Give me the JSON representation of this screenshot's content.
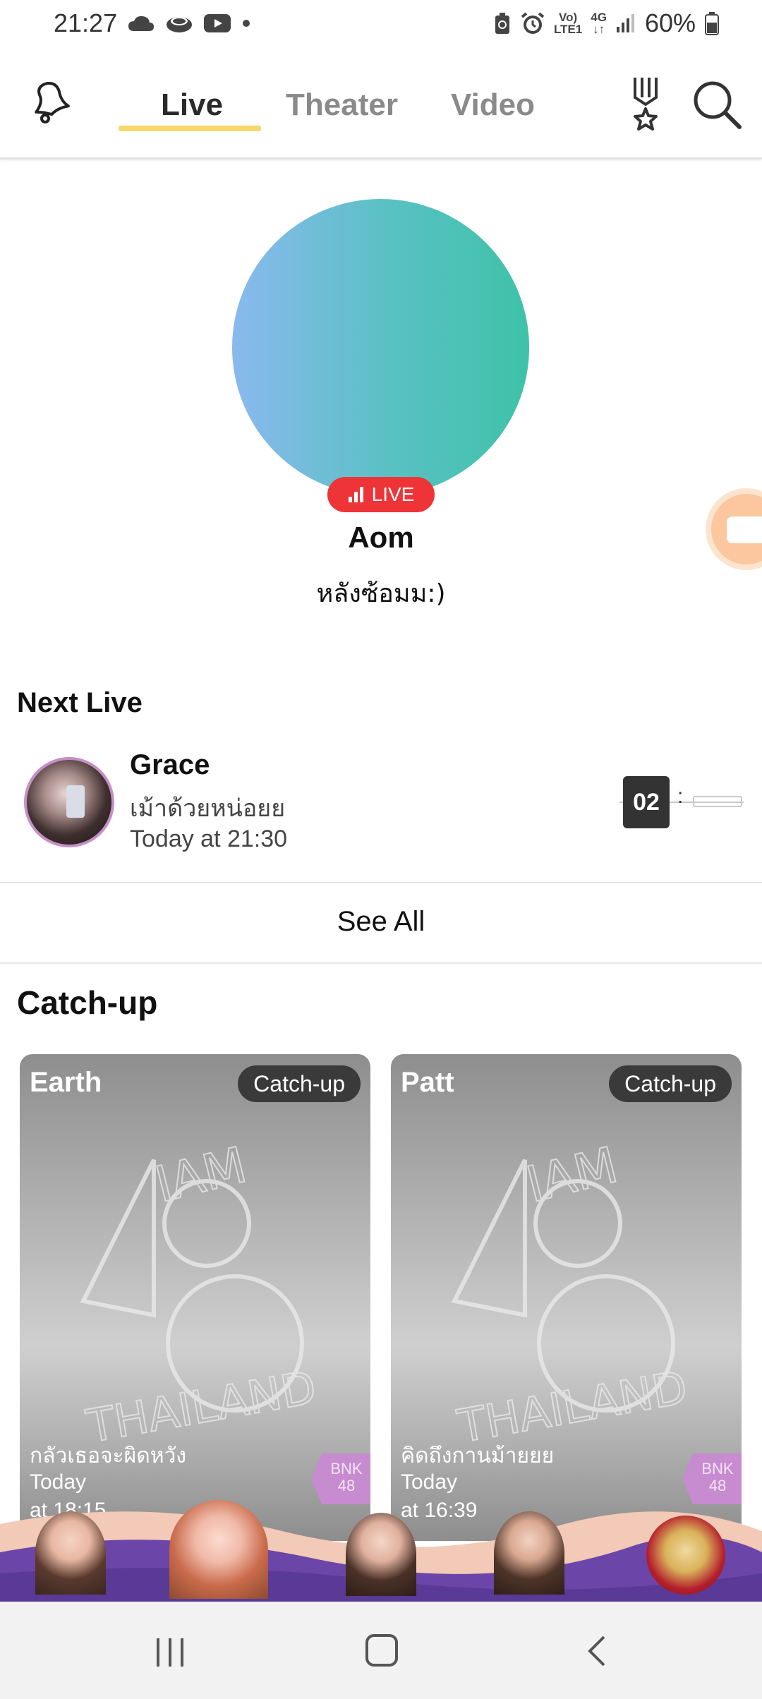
{
  "status_bar": {
    "time": "21:27",
    "battery": "60%",
    "network_top": "Vo)",
    "network_bottom": "LTE1",
    "network_gen": "4G"
  },
  "nav": {
    "tabs": [
      {
        "label": "Live",
        "active": true
      },
      {
        "label": "Theater",
        "active": false
      },
      {
        "label": "Video",
        "active": false
      }
    ],
    "accent_color": "#f7d66a"
  },
  "live_now": {
    "badge": "LIVE",
    "name": "Aom",
    "caption": "หลังซ้อมม:)",
    "badge_color": "#ef3438"
  },
  "next_live": {
    "section_title": "Next Live",
    "name": "Grace",
    "caption": "เม้าด้วยหน่อยย",
    "time": "Today at 21:30",
    "countdown_value": "02",
    "countdown_separator": ":"
  },
  "see_all": "See All",
  "catch_up": {
    "section_title": "Catch-up",
    "cards": [
      {
        "name": "Earth",
        "badge": "Catch-up",
        "caption": "กลัวเธอจะผิดหวัง",
        "date": "Today",
        "time": "at 18:15",
        "flag": "BNK 48"
      },
      {
        "name": "Patt",
        "badge": "Catch-up",
        "caption": "คิดถึงกานม้ายยย",
        "date": "Today",
        "time": "at 16:39",
        "flag": "BNK 48"
      }
    ]
  }
}
